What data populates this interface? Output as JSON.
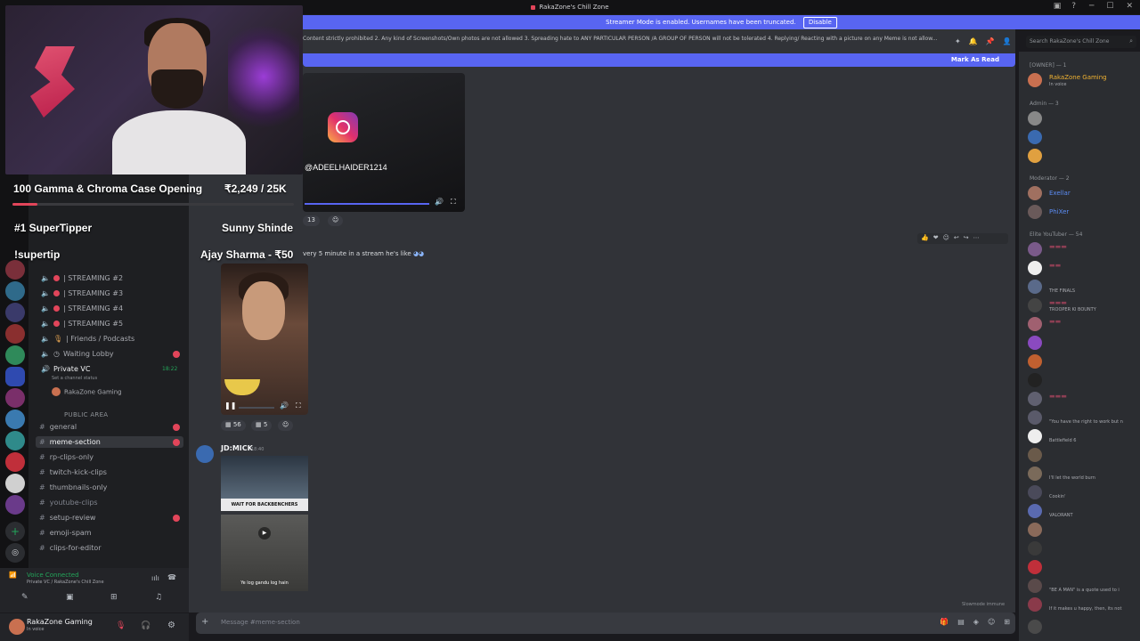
{
  "window": {
    "title": "RakaZone's Chill Zone"
  },
  "banner": {
    "text": "Streamer Mode is enabled. Usernames have been truncated.",
    "disable_label": "Disable"
  },
  "header": {
    "topic": "Content strictly prohibited 2. Any kind of Screenshots/Own photos are not allowed 3. Spreading hate to ANY PARTICULAR PERSON /A GROUP OF PERSON will not be tolerated 4. Replying/ Reacting with a picture on any Meme is not allow...",
    "search_placeholder": "Search RakaZone's Chill Zone",
    "mark_as_read": "Mark As Read"
  },
  "overlay": {
    "goal_title": "100 Gamma & Chroma Case Opening",
    "goal_amount": "₹2,249 / 25K",
    "goal_progress": 0.09,
    "top_tipper_label": "#1 SuperTipper",
    "top_tipper_name": "Sunny Shinde",
    "command": "!supertip",
    "last_tip": "Ajay Sharma - ₹50"
  },
  "sidebar": {
    "voice_channels": [
      {
        "label": "| STREAMING #2"
      },
      {
        "label": "| STREAMING #3"
      },
      {
        "label": "| STREAMING #4"
      },
      {
        "label": "| STREAMING #5"
      },
      {
        "label": "| Friends / Podcasts"
      },
      {
        "label": "Waiting Lobby"
      }
    ],
    "private_vc": {
      "label": "Private VC",
      "time": "18:22",
      "status": "Set a channel status",
      "member": "RakaZone Gaming"
    },
    "section_label": "PUBLIC AREA",
    "text_channels": [
      {
        "label": "general"
      },
      {
        "label": "meme-section"
      },
      {
        "label": "rp-clips-only"
      },
      {
        "label": "twitch-kick-clips"
      },
      {
        "label": "thumbnails-only"
      },
      {
        "label": "youtube-clips"
      },
      {
        "label": "setup-review"
      },
      {
        "label": "emoji-spam"
      },
      {
        "label": "clips-for-editor"
      }
    ],
    "voice_status": {
      "title": "Voice Connected",
      "subtitle": "Private VC / RakaZone's Chill Zone"
    },
    "user": {
      "name": "RakaZone Gaming",
      "status": "In voice"
    }
  },
  "chat": {
    "msg1": {
      "insta_handle": "@ADEELHAIDER1214",
      "reaction_count": "13"
    },
    "msg2": {
      "text": "very 5 minute in a stream he's like",
      "reaction1_count": "56",
      "reaction2_count": "5"
    },
    "msg3": {
      "author": "JD:MICK",
      "time": "18:40",
      "meme_caption": "WAIT FOR BACKBENCHERS",
      "video_sub": "Ye log gandu log hain"
    },
    "composer_placeholder": "Message #meme-section",
    "slowmode": "Slowmode immune"
  },
  "members": {
    "owner_header": "[OWNER] — 1",
    "owner": {
      "name": "RakaZone Gaming",
      "status": "In voice"
    },
    "admin_header": "Admin — 3",
    "moderator_header": "Moderator — 2",
    "moderators": [
      {
        "name": "Exellar"
      },
      {
        "name": "PhiXer"
      }
    ],
    "elite_header": "Elite YouTuber — 54",
    "elite_statuses": [
      "THE FINALS",
      "TROOPER KI BOUNTY",
      "\"You have the right to work but n",
      "Battlefield 6",
      "I'll let the world burn",
      "Cookin'",
      "VALORANT",
      "\"BE A MAN\" is a quote used to i",
      "If it makes u happy, then, its not"
    ]
  },
  "colors": {
    "accent": "#5865f2",
    "danger": "#e2455a",
    "online": "#23a55a",
    "mod_name": "#5c8df5",
    "elite_name": "#ec4f76"
  }
}
